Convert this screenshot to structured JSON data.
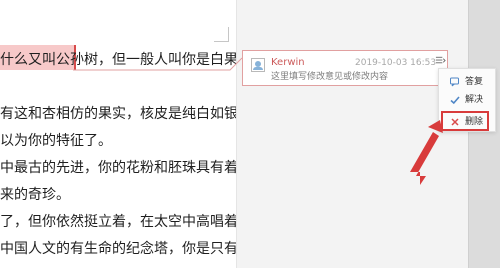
{
  "document": {
    "lines": [
      "什么又叫公孙树，但一般人叫你是白果，那是容",
      "有这和杏相仿的果实，核皮是纯白如银，核仁是",
      "以为你的特征了。",
      "中最古的先进，你的花粉和胚珠具有着动物般的",
      "来的奇珍。",
      "了，但你依然挺立着，在太空中高唱着人间胜利",
      "中国人文的有生命的纪念塔，你是只有中国才有"
    ]
  },
  "comment": {
    "author": "Kerwin",
    "timestamp": "2019-10-03 16:53",
    "text": "这里填写修改意见或修改内容"
  },
  "menu": {
    "items": [
      {
        "label": "答复",
        "icon": "reply-icon"
      },
      {
        "label": "解决",
        "icon": "check-icon"
      },
      {
        "label": "删除",
        "icon": "close-icon"
      }
    ]
  },
  "colors": {
    "highlight": "#f7c9c9",
    "comment_border": "#e1a0a0",
    "author": "#cc5b5b",
    "arrow": "#d83b3b"
  }
}
